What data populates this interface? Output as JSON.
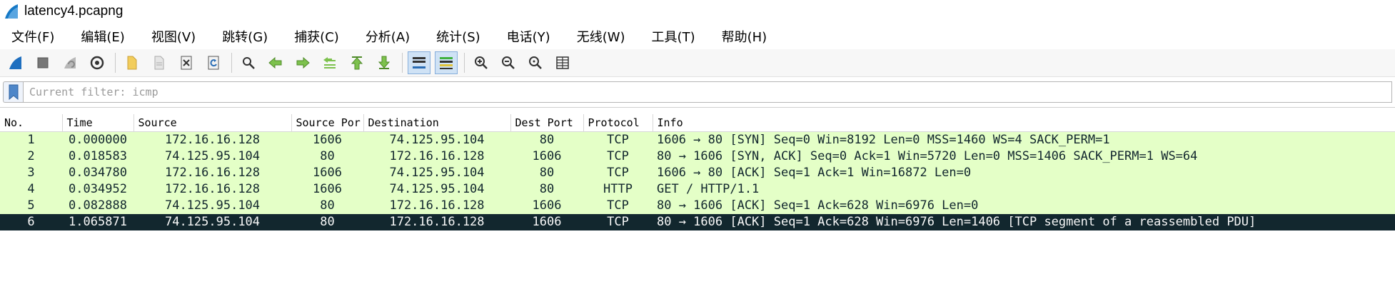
{
  "window": {
    "title": "latency4.pcapng"
  },
  "menu": [
    "文件(F)",
    "编辑(E)",
    "视图(V)",
    "跳转(G)",
    "捕获(C)",
    "分析(A)",
    "统计(S)",
    "电话(Y)",
    "无线(W)",
    "工具(T)",
    "帮助(H)"
  ],
  "toolbar": {
    "icons": [
      "shark-fin-start-icon",
      "stop-capture-icon",
      "restart-capture-icon",
      "capture-options-icon",
      "open-file-icon",
      "save-file-icon",
      "close-file-icon",
      "reload-file-icon",
      "find-packet-icon",
      "go-back-icon",
      "go-forward-icon",
      "go-to-packet-icon",
      "first-packet-icon",
      "last-packet-icon",
      "auto-scroll-icon",
      "colorize-icon",
      "zoom-in-icon",
      "zoom-out-icon",
      "normal-size-icon",
      "resize-columns-icon"
    ],
    "active": [
      "auto-scroll-icon",
      "colorize-icon"
    ]
  },
  "filter": {
    "placeholder": "Current filter: icmp",
    "value": ""
  },
  "packet_list": {
    "columns": [
      "No.",
      "Time",
      "Source",
      "Source Por",
      "Destination",
      "Dest Port",
      "Protocol",
      "Info"
    ],
    "rows": [
      {
        "no": "1",
        "time": "0.000000",
        "source": "172.16.16.128",
        "src_port": "1606",
        "destination": "74.125.95.104",
        "dst_port": "80",
        "protocol": "TCP",
        "info": "1606 → 80 [SYN] Seq=0 Win=8192 Len=0 MSS=1460 WS=4 SACK_PERM=1",
        "selected": false
      },
      {
        "no": "2",
        "time": "0.018583",
        "source": "74.125.95.104",
        "src_port": "80",
        "destination": "172.16.16.128",
        "dst_port": "1606",
        "protocol": "TCP",
        "info": "80 → 1606 [SYN, ACK] Seq=0 Ack=1 Win=5720 Len=0 MSS=1406 SACK_PERM=1 WS=64",
        "selected": false
      },
      {
        "no": "3",
        "time": "0.034780",
        "source": "172.16.16.128",
        "src_port": "1606",
        "destination": "74.125.95.104",
        "dst_port": "80",
        "protocol": "TCP",
        "info": "1606 → 80 [ACK] Seq=1 Ack=1 Win=16872 Len=0",
        "selected": false
      },
      {
        "no": "4",
        "time": "0.034952",
        "source": "172.16.16.128",
        "src_port": "1606",
        "destination": "74.125.95.104",
        "dst_port": "80",
        "protocol": "HTTP",
        "info": "GET / HTTP/1.1",
        "selected": false
      },
      {
        "no": "5",
        "time": "0.082888",
        "source": "74.125.95.104",
        "src_port": "80",
        "destination": "172.16.16.128",
        "dst_port": "1606",
        "protocol": "TCP",
        "info": "80 → 1606 [ACK] Seq=1 Ack=628 Win=6976 Len=0",
        "selected": false
      },
      {
        "no": "6",
        "time": "1.065871",
        "source": "74.125.95.104",
        "src_port": "80",
        "destination": "172.16.16.128",
        "dst_port": "1606",
        "protocol": "TCP",
        "info": "80 → 1606 [ACK] Seq=1 Ack=628 Win=6976 Len=1406 [TCP segment of a reassembled PDU]",
        "selected": true
      }
    ]
  },
  "colors": {
    "row_bg": "#e4ffc7",
    "row_fg": "#12272e",
    "selected_bg": "#12272e",
    "selected_fg": "#f7f7f7"
  }
}
